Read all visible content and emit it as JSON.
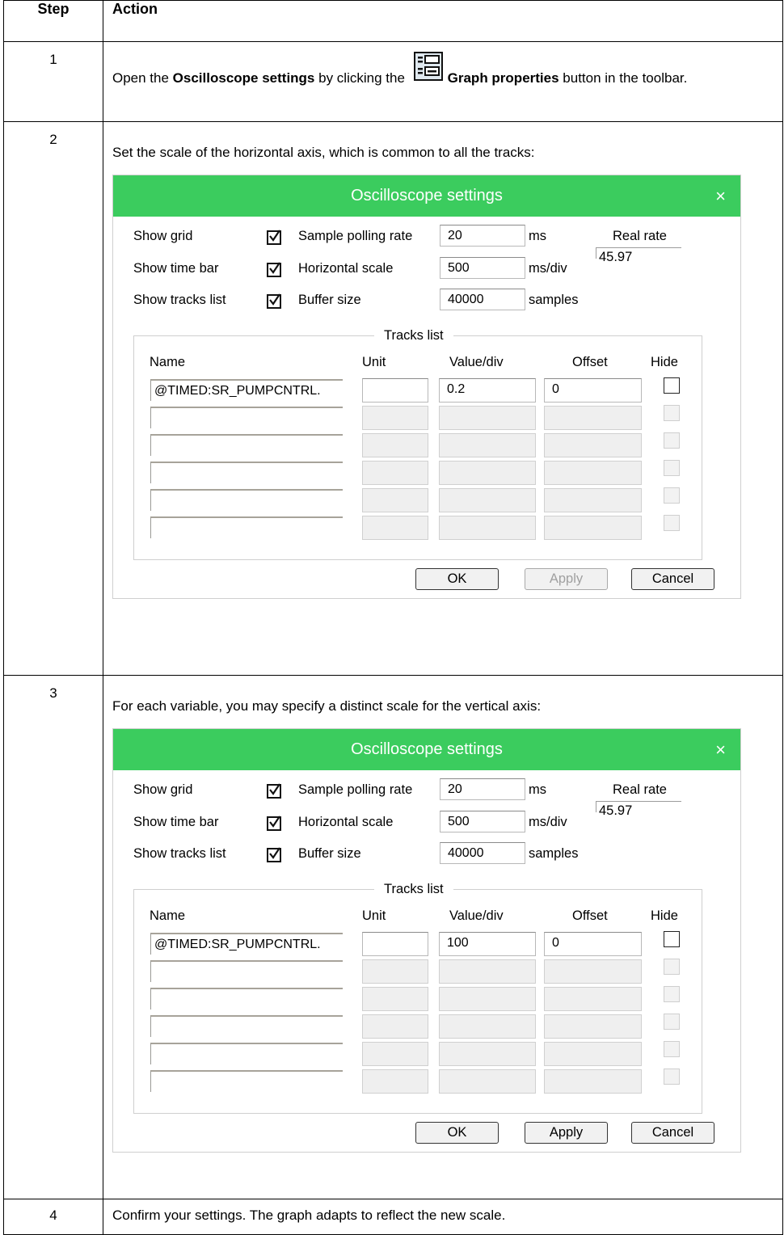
{
  "table": {
    "header": {
      "step": "Step",
      "action": "Action"
    },
    "rows": [
      {
        "step": "1",
        "text_before": "Open the ",
        "bold1": "Oscilloscope settings",
        "text_mid": " by clicking the ",
        "bold2": "Graph properties",
        "text_after": " button in the toolbar.",
        "icon": "graph-properties-icon"
      },
      {
        "step": "2",
        "text": "Set the scale of the horizontal axis, which is common to all the tracks:"
      },
      {
        "step": "3",
        "text": "For each variable, you may specify a distinct scale for the vertical axis:"
      },
      {
        "step": "4",
        "text": "Confirm your settings. The graph adapts to reflect the new scale."
      }
    ]
  },
  "dialogs": [
    {
      "title": "Oscilloscope settings",
      "close_icon": "×",
      "show_grid": "Show grid",
      "show_time_bar": "Show time bar",
      "show_tracks_list": "Show tracks list",
      "sample_polling_rate": "Sample polling rate",
      "sample_polling_rate_value": "20",
      "sample_polling_rate_unit": "ms",
      "horizontal_scale": "Horizontal scale",
      "horizontal_scale_value": "500",
      "horizontal_scale_unit": "ms/div",
      "buffer_size": "Buffer size",
      "buffer_size_value": "40000",
      "buffer_size_unit": "samples",
      "real_rate_label": "Real rate",
      "real_rate_value": "45.97",
      "tracks_list_title": "Tracks list",
      "col_name": "Name",
      "col_unit": "Unit",
      "col_value_div": "Value/div",
      "col_offset": "Offset",
      "col_hide": "Hide",
      "track_name": "@TIMED:SR_PUMPCNTRL.",
      "track_unit": "",
      "track_value_div": "0.2",
      "track_offset": "0",
      "ok": "OK",
      "apply": "Apply",
      "cancel": "Cancel",
      "apply_enabled": false
    },
    {
      "title": "Oscilloscope settings",
      "close_icon": "×",
      "show_grid": "Show grid",
      "show_time_bar": "Show time bar",
      "show_tracks_list": "Show tracks list",
      "sample_polling_rate": "Sample polling rate",
      "sample_polling_rate_value": "20",
      "sample_polling_rate_unit": "ms",
      "horizontal_scale": "Horizontal scale",
      "horizontal_scale_value": "500",
      "horizontal_scale_unit": "ms/div",
      "buffer_size": "Buffer size",
      "buffer_size_value": "40000",
      "buffer_size_unit": "samples",
      "real_rate_label": "Real rate",
      "real_rate_value": "45.97",
      "tracks_list_title": "Tracks list",
      "col_name": "Name",
      "col_unit": "Unit",
      "col_value_div": "Value/div",
      "col_offset": "Offset",
      "col_hide": "Hide",
      "track_name": "@TIMED:SR_PUMPCNTRL.",
      "track_unit": "",
      "track_value_div": "100",
      "track_offset": "0",
      "ok": "OK",
      "apply": "Apply",
      "cancel": "Cancel",
      "apply_enabled": true
    }
  ],
  "colors": {
    "title_bar": "#3bcc5e"
  }
}
